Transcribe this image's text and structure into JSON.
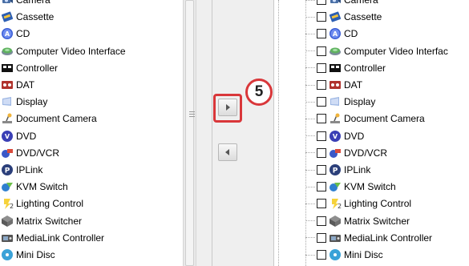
{
  "left_list": {
    "items": [
      {
        "label": "Camera",
        "icon": "camera-icon"
      },
      {
        "label": "Cassette",
        "icon": "cassette-icon"
      },
      {
        "label": "CD",
        "icon": "cd-icon"
      },
      {
        "label": "Computer Video Interface",
        "icon": "computer-video-interface-icon"
      },
      {
        "label": "Controller",
        "icon": "controller-icon"
      },
      {
        "label": "DAT",
        "icon": "dat-icon"
      },
      {
        "label": "Display",
        "icon": "display-icon"
      },
      {
        "label": "Document Camera",
        "icon": "document-camera-icon"
      },
      {
        "label": "DVD",
        "icon": "dvd-icon"
      },
      {
        "label": "DVD/VCR",
        "icon": "dvd-vcr-icon"
      },
      {
        "label": "IPLink",
        "icon": "iplink-icon"
      },
      {
        "label": "KVM Switch",
        "icon": "kvm-switch-icon"
      },
      {
        "label": "Lighting Control",
        "icon": "lighting-control-icon"
      },
      {
        "label": "Matrix Switcher",
        "icon": "matrix-switcher-icon"
      },
      {
        "label": "MediaLink Controller",
        "icon": "medialink-controller-icon"
      },
      {
        "label": "Mini Disc",
        "icon": "mini-disc-icon"
      }
    ]
  },
  "right_list": {
    "items": [
      {
        "label": "Camera",
        "icon": "camera-icon"
      },
      {
        "label": "Cassette",
        "icon": "cassette-icon"
      },
      {
        "label": "CD",
        "icon": "cd-icon"
      },
      {
        "label": "Computer Video Interfac",
        "icon": "computer-video-interface-icon"
      },
      {
        "label": "Controller",
        "icon": "controller-icon"
      },
      {
        "label": "DAT",
        "icon": "dat-icon"
      },
      {
        "label": "Display",
        "icon": "display-icon"
      },
      {
        "label": "Document Camera",
        "icon": "document-camera-icon"
      },
      {
        "label": "DVD",
        "icon": "dvd-icon"
      },
      {
        "label": "DVD/VCR",
        "icon": "dvd-vcr-icon"
      },
      {
        "label": "IPLink",
        "icon": "iplink-icon"
      },
      {
        "label": "KVM Switch",
        "icon": "kvm-switch-icon"
      },
      {
        "label": "Lighting Control",
        "icon": "lighting-control-icon"
      },
      {
        "label": "Matrix Switcher",
        "icon": "matrix-switcher-icon"
      },
      {
        "label": "MediaLink Controller",
        "icon": "medialink-controller-icon"
      },
      {
        "label": "Mini Disc",
        "icon": "mini-disc-icon"
      }
    ]
  },
  "buttons": {
    "add_icon": "arrow-right-icon",
    "remove_icon": "arrow-left-icon"
  },
  "callout": {
    "step_number": "5",
    "highlight_color": "#d9373a"
  }
}
